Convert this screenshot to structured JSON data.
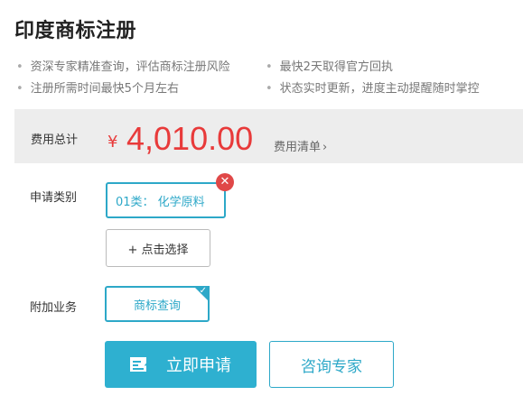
{
  "title": "印度商标注册",
  "features": [
    "资深专家精准查询，评估商标注册风险",
    "最快2天取得官方回执",
    "注册所需时间最快5个月左右",
    "状态实时更新，进度主动提醒随时掌控"
  ],
  "fee": {
    "label": "费用总计",
    "currency": "¥",
    "amount": "4,010.00",
    "list_link": "费用清单"
  },
  "category": {
    "label": "申请类别",
    "selected": "01类： 化学原料",
    "select_button": "+ 点击选择"
  },
  "addon": {
    "label": "附加业务",
    "selected": "商标查询"
  },
  "actions": {
    "apply": "立即申请",
    "consult": "咨询专家"
  },
  "colors": {
    "accent": "#2da8c8",
    "price": "#e83a3a",
    "remove": "#e04848"
  }
}
